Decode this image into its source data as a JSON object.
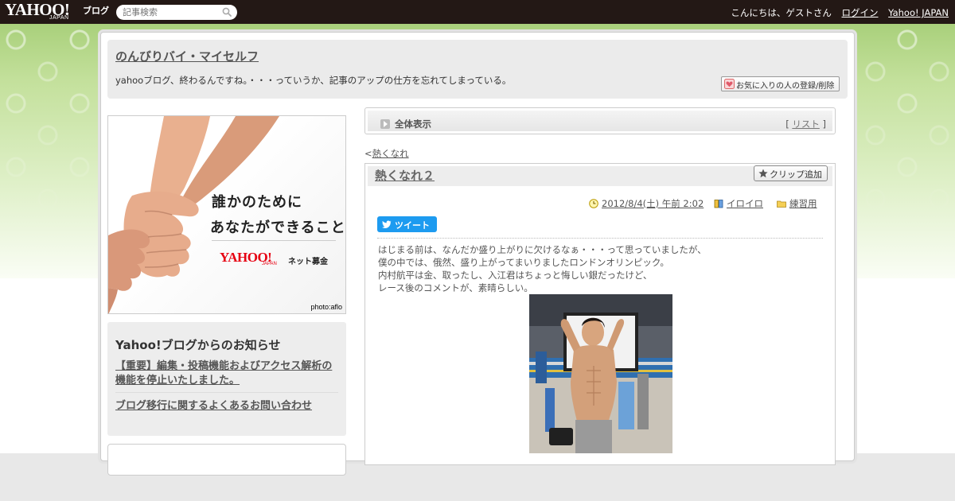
{
  "topbar": {
    "logo_yahoo": "YAHOO!",
    "logo_japan": "JAPAN",
    "logo_blog": "ブログ",
    "search_placeholder": "記事検索",
    "greeting": "こんにちは、ゲストさん",
    "login": "ログイン",
    "yahoo_japan": "Yahoo! JAPAN"
  },
  "blog": {
    "title": "のんびりバイ・マイセルフ",
    "description": "yahooブログ、終わるんですね。・・・っていうか、記事のアップの仕方を忘れてしまっている。",
    "fav_button": "お気に入りの人の登録/削除"
  },
  "banner": {
    "line1": "誰かのために",
    "line2": "あなたができること",
    "yahoo": "YAHOO!",
    "japan": "JAPAN",
    "service": "ネット募金",
    "credit": "photo:aflo"
  },
  "notice": {
    "heading": "Yahoo!ブログからのお知らせ",
    "items": [
      "【重要】編集・投稿機能およびアクセス解析の機能を停止いたしました。",
      "ブログ移行に関するよくあるお問い合わせ"
    ]
  },
  "tabbar": {
    "label": "全体表示",
    "list_open": "[ ",
    "list_link": "リスト",
    "list_close": " ]"
  },
  "nav": {
    "prev_marker": "<",
    "prev_link": "熱くなれ"
  },
  "article": {
    "title": "熱くなれ２",
    "clip_button": "クリップ追加",
    "date": "2012/8/4(土) 午前 2:02",
    "category": "イロイロ",
    "folder": "練習用",
    "tweet": "ツイート",
    "body": [
      "はじまる前は、なんだか盛り上がりに欠けるなぁ・・・って思っていましたが、",
      "僕の中では、俄然、盛り上がってまいりましたロンドンオリンピック。",
      "内村航平は金、取ったし、入江君はちょっと悔しい銀だったけど、",
      "レース後のコメントが、素晴らしい。"
    ]
  },
  "icons": {
    "search": "search-icon",
    "heart": "heart-icon",
    "star": "star-icon",
    "clock": "clock-icon",
    "book": "book-icon",
    "folder": "folder-icon",
    "bird": "twitter-bird-icon"
  },
  "colors": {
    "topbar": "#231815",
    "tweet": "#1d9bf0",
    "yahoo_red": "#e60012"
  }
}
